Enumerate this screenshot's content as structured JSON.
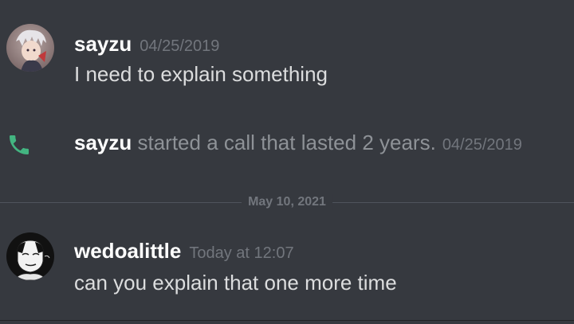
{
  "messages": [
    {
      "username": "sayzu",
      "timestamp": "04/25/2019",
      "text": "I need to explain something",
      "avatar": "sayzu-avatar"
    },
    {
      "username": "wedoalittle",
      "timestamp": "Today at 12:07",
      "text": "can you explain that one more time",
      "avatar": "wedoalittle-avatar"
    }
  ],
  "call": {
    "icon": "phone-icon",
    "icon_color": "#43b581",
    "username": "sayzu",
    "text": " started a call that lasted 2 years.",
    "timestamp": "04/25/2019"
  },
  "divider": {
    "label": "May 10, 2021"
  },
  "colors": {
    "background": "#36393f",
    "username": "#ffffff",
    "timestamp": "#72767d",
    "message_text": "#dcddde",
    "call_green": "#43b581"
  }
}
